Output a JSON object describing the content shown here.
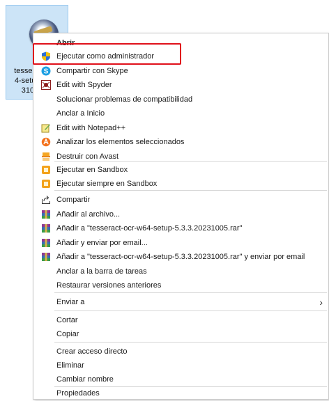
{
  "file": {
    "label_lines": [
      "tesserac",
      "4-setup-",
      "3100"
    ]
  },
  "menu": {
    "items": [
      {
        "label": "Abrir",
        "bold": true,
        "icon": "none"
      },
      {
        "label": "Ejecutar como administrador",
        "icon": "uac-shield-icon"
      },
      {
        "label": "Compartir con Skype",
        "icon": "skype-icon"
      },
      {
        "label": "Edit with Spyder",
        "icon": "spyder-icon"
      },
      {
        "label": "Solucionar problemas de compatibilidad",
        "icon": "none"
      },
      {
        "label": "Anclar a Inicio",
        "icon": "none"
      },
      {
        "label": "Edit with Notepad++",
        "icon": "notepadpp-icon"
      },
      {
        "label": "Analizar los elementos seleccionados",
        "icon": "avast-scan-icon"
      },
      {
        "label": "Destruir con Avast",
        "icon": "shredder-icon"
      },
      {
        "label": "Ejecutar en Sandbox",
        "icon": "sandbox-icon"
      },
      {
        "label": "Ejecutar siempre en Sandbox",
        "icon": "sandbox-icon"
      },
      {
        "label": "Compartir",
        "icon": "share-icon"
      },
      {
        "label": "Añadir al archivo...",
        "icon": "winrar-icon"
      },
      {
        "label": "Añadir a \"tesseract-ocr-w64-setup-5.3.3.20231005.rar\"",
        "icon": "winrar-icon"
      },
      {
        "label": "Añadir y enviar por email...",
        "icon": "winrar-icon"
      },
      {
        "label": "Añadir a \"tesseract-ocr-w64-setup-5.3.3.20231005.rar\" y enviar por email",
        "icon": "winrar-icon"
      },
      {
        "label": "Anclar a la barra de tareas",
        "icon": "none"
      },
      {
        "label": "Restaurar versiones anteriores",
        "icon": "none"
      },
      {
        "label": "Enviar a",
        "icon": "none",
        "submenu": true
      },
      {
        "label": "Cortar",
        "icon": "none"
      },
      {
        "label": "Copiar",
        "icon": "none"
      },
      {
        "label": "Crear acceso directo",
        "icon": "none"
      },
      {
        "label": "Eliminar",
        "icon": "none"
      },
      {
        "label": "Cambiar nombre",
        "icon": "none"
      },
      {
        "label": "Propiedades",
        "icon": "none"
      }
    ],
    "submenu_arrow": "›"
  },
  "colors": {
    "highlight_border": "#e0101a",
    "file_selection_bg": "#cce4f7"
  }
}
